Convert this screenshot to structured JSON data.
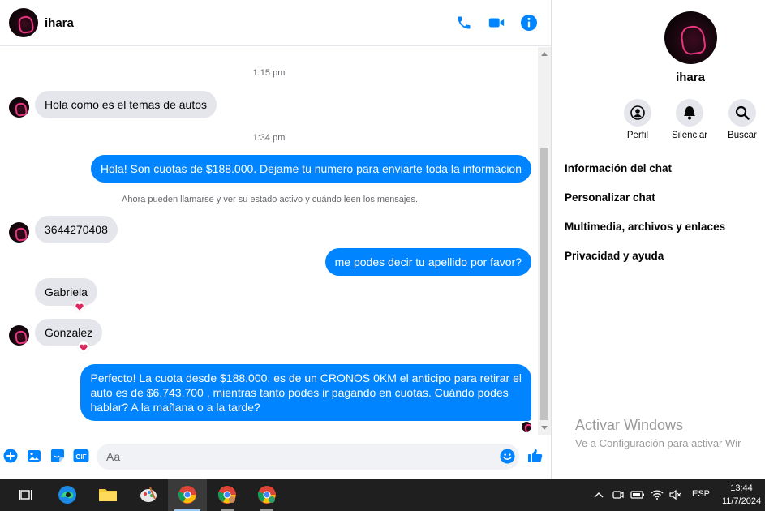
{
  "contact": {
    "name": "ihara"
  },
  "header": {
    "icons": [
      "phone-icon",
      "video-camera-icon",
      "info-icon"
    ],
    "accent": "#0084ff"
  },
  "conversation": {
    "timestamp_1": "1:15 pm",
    "msg_1": "Hola como es el temas de autos",
    "timestamp_2": "1:34 pm",
    "msg_2": "Hola! Son cuotas de $188.000. Dejame tu numero para enviarte toda la informacion",
    "notice": "Ahora pueden llamarse y ver su estado activo y cuándo leen los mensajes.",
    "msg_3": "3644270408",
    "msg_4": "me podes decir tu apellido por favor?",
    "msg_5": "Gabriela",
    "msg_6": "Gonzalez",
    "msg_7_line_1": "Perfecto! La cuota desde $188.000. es de un CRONOS 0KM el anticipo para retirar el",
    "msg_7_line_2": "auto es de $6.743.700 , mientras tanto podes ir pagando en cuotas. Cuándo podes",
    "msg_7_line_3": "hablar? A la mañana o a la tarde?",
    "reaction": "heart-icon"
  },
  "composer": {
    "placeholder": "Aa",
    "icons": [
      "plus-circle-icon",
      "image-icon",
      "sticker-icon",
      "gif-icon",
      "emoji-icon",
      "thumbs-up-icon"
    ],
    "gif_label": "GIF"
  },
  "info_panel": {
    "name": "ihara",
    "actions": [
      {
        "label": "Perfil",
        "icon": "profile-icon"
      },
      {
        "label": "Silenciar",
        "icon": "bell-icon"
      },
      {
        "label": "Buscar",
        "icon": "search-icon"
      }
    ],
    "menu": [
      "Información del chat",
      "Personalizar chat",
      "Multimedia, archivos y enlaces",
      "Privacidad y ayuda"
    ]
  },
  "watermark": {
    "title": "Activar Windows",
    "subtitle": "Ve a Configuración para activar Wir"
  },
  "taskbar": {
    "apps": [
      "task-view-icon",
      "edge-icon",
      "file-explorer-icon",
      "paint-icon",
      "chrome-icon",
      "chrome-icon",
      "chrome-icon"
    ],
    "language": "ESP",
    "time": "13:44",
    "date": "11/7/2024"
  }
}
